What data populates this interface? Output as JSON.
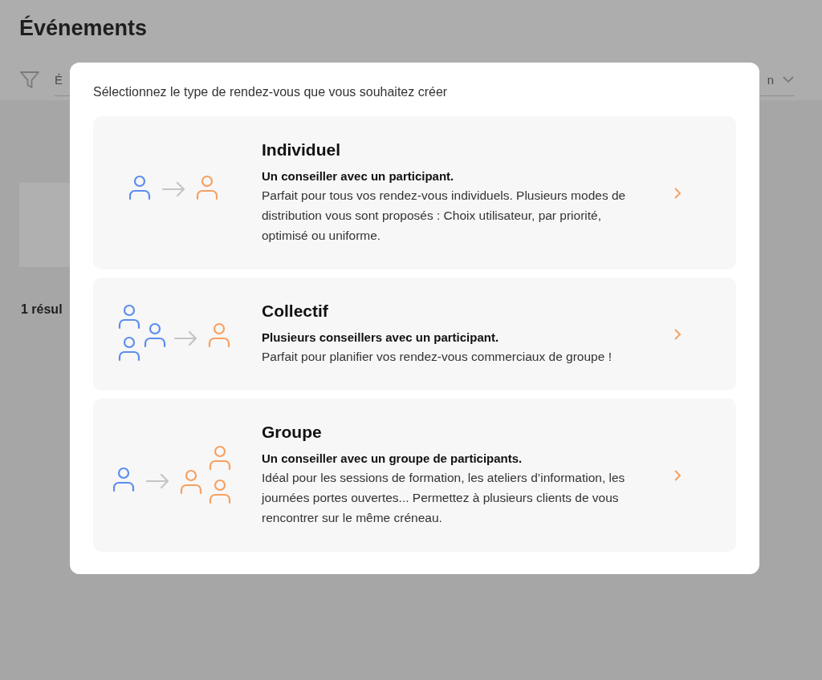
{
  "page": {
    "title": "Événements",
    "filter_field": {
      "value": "É"
    },
    "sort_field": {
      "value": "n"
    },
    "result_count": "1 résul"
  },
  "modal": {
    "prompt": "Sélectionnez le type de rendez-vous que vous souhaitez créer",
    "options": [
      {
        "kind": "individual",
        "title": "Individuel",
        "subtitle": "Un conseiller avec un participant.",
        "description": "Parfait pour tous vos rendez-vous individuels. Plusieurs modes de distribution vous sont proposés : Choix utilisateur, par priorité, optimisé ou uniforme."
      },
      {
        "kind": "collective",
        "title": "Collectif",
        "subtitle": "Plusieurs conseillers avec un participant.",
        "description": "Parfait pour planifier vos rendez-vous commerciaux de groupe !"
      },
      {
        "kind": "group",
        "title": "Groupe",
        "subtitle": "Un conseiller avec un groupe de participants.",
        "description": "Idéal pour les sessions de formation, les ateliers d’information, les journées portes ouvertes... Permettez à plusieurs clients de vous rencontrer sur le même créneau."
      }
    ]
  }
}
